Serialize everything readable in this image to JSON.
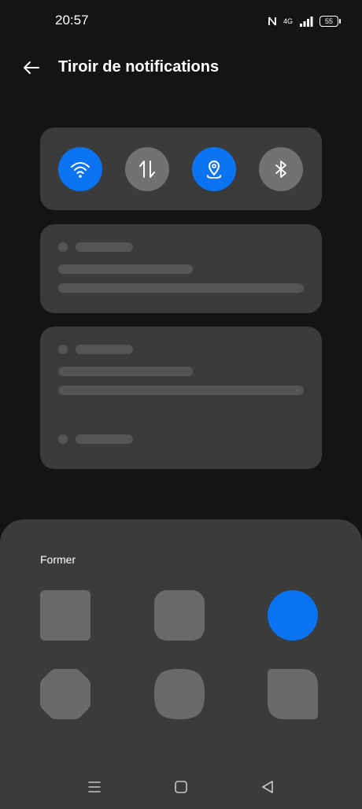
{
  "status_bar": {
    "time": "20:57",
    "network": "4G",
    "battery": "55"
  },
  "header": {
    "title": "Tiroir de notifications"
  },
  "quick_settings": {
    "accent_color": "#0a73f2",
    "tiles": [
      {
        "icon": "wifi-icon",
        "active": true
      },
      {
        "icon": "data-transfer-icon",
        "active": false
      },
      {
        "icon": "location-icon",
        "active": true
      },
      {
        "icon": "bluetooth-icon",
        "active": false
      }
    ]
  },
  "shape_picker": {
    "label": "Former",
    "options": [
      {
        "shape": "square",
        "selected": false
      },
      {
        "shape": "rounded-square",
        "selected": false
      },
      {
        "shape": "circle",
        "selected": true
      },
      {
        "shape": "octagon",
        "selected": false
      },
      {
        "shape": "squircle",
        "selected": false
      },
      {
        "shape": "leaf",
        "selected": false
      }
    ]
  },
  "navigation": {
    "buttons": [
      "menu-icon",
      "home-icon",
      "back-triangle-icon"
    ]
  }
}
